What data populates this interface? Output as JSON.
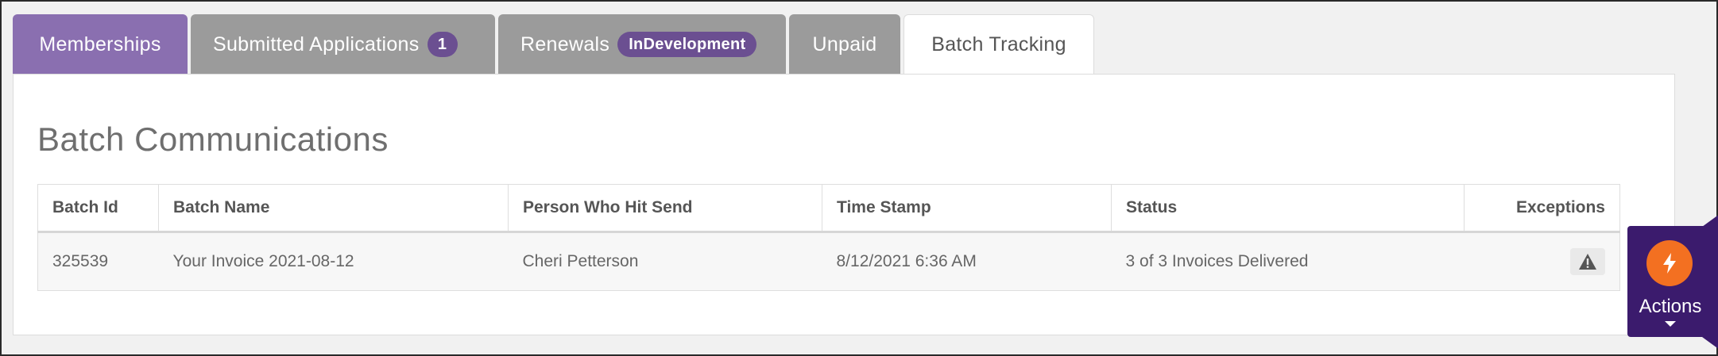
{
  "tabs": [
    {
      "label": "Memberships",
      "state": "active"
    },
    {
      "label": "Submitted Applications",
      "badge": "1"
    },
    {
      "label": "Renewals",
      "badge": "InDevelopment"
    },
    {
      "label": "Unpaid"
    },
    {
      "label": "Batch Tracking",
      "state": "selected"
    }
  ],
  "page_title": "Batch Communications",
  "table": {
    "headers": [
      "Batch Id",
      "Batch Name",
      "Person Who Hit Send",
      "Time Stamp",
      "Status",
      "Exceptions"
    ],
    "rows": [
      [
        "325539",
        "Your Invoice 2021-08-12",
        "Cheri Petterson",
        "8/12/2021 6:36 AM",
        "3 of 3 Invoices Delivered"
      ]
    ]
  },
  "icons": {
    "exceptions": "warning-triangle-icon",
    "actions": "lightning-bolt-icon"
  },
  "actions_button": {
    "label": "Actions"
  },
  "colors": {
    "tab_active": "#8a6fb0",
    "tab_inactive": "#9b9b9b",
    "badge": "#6b4f91",
    "actions_bg": "#3b1b6d",
    "actions_icon": "#f37021"
  }
}
